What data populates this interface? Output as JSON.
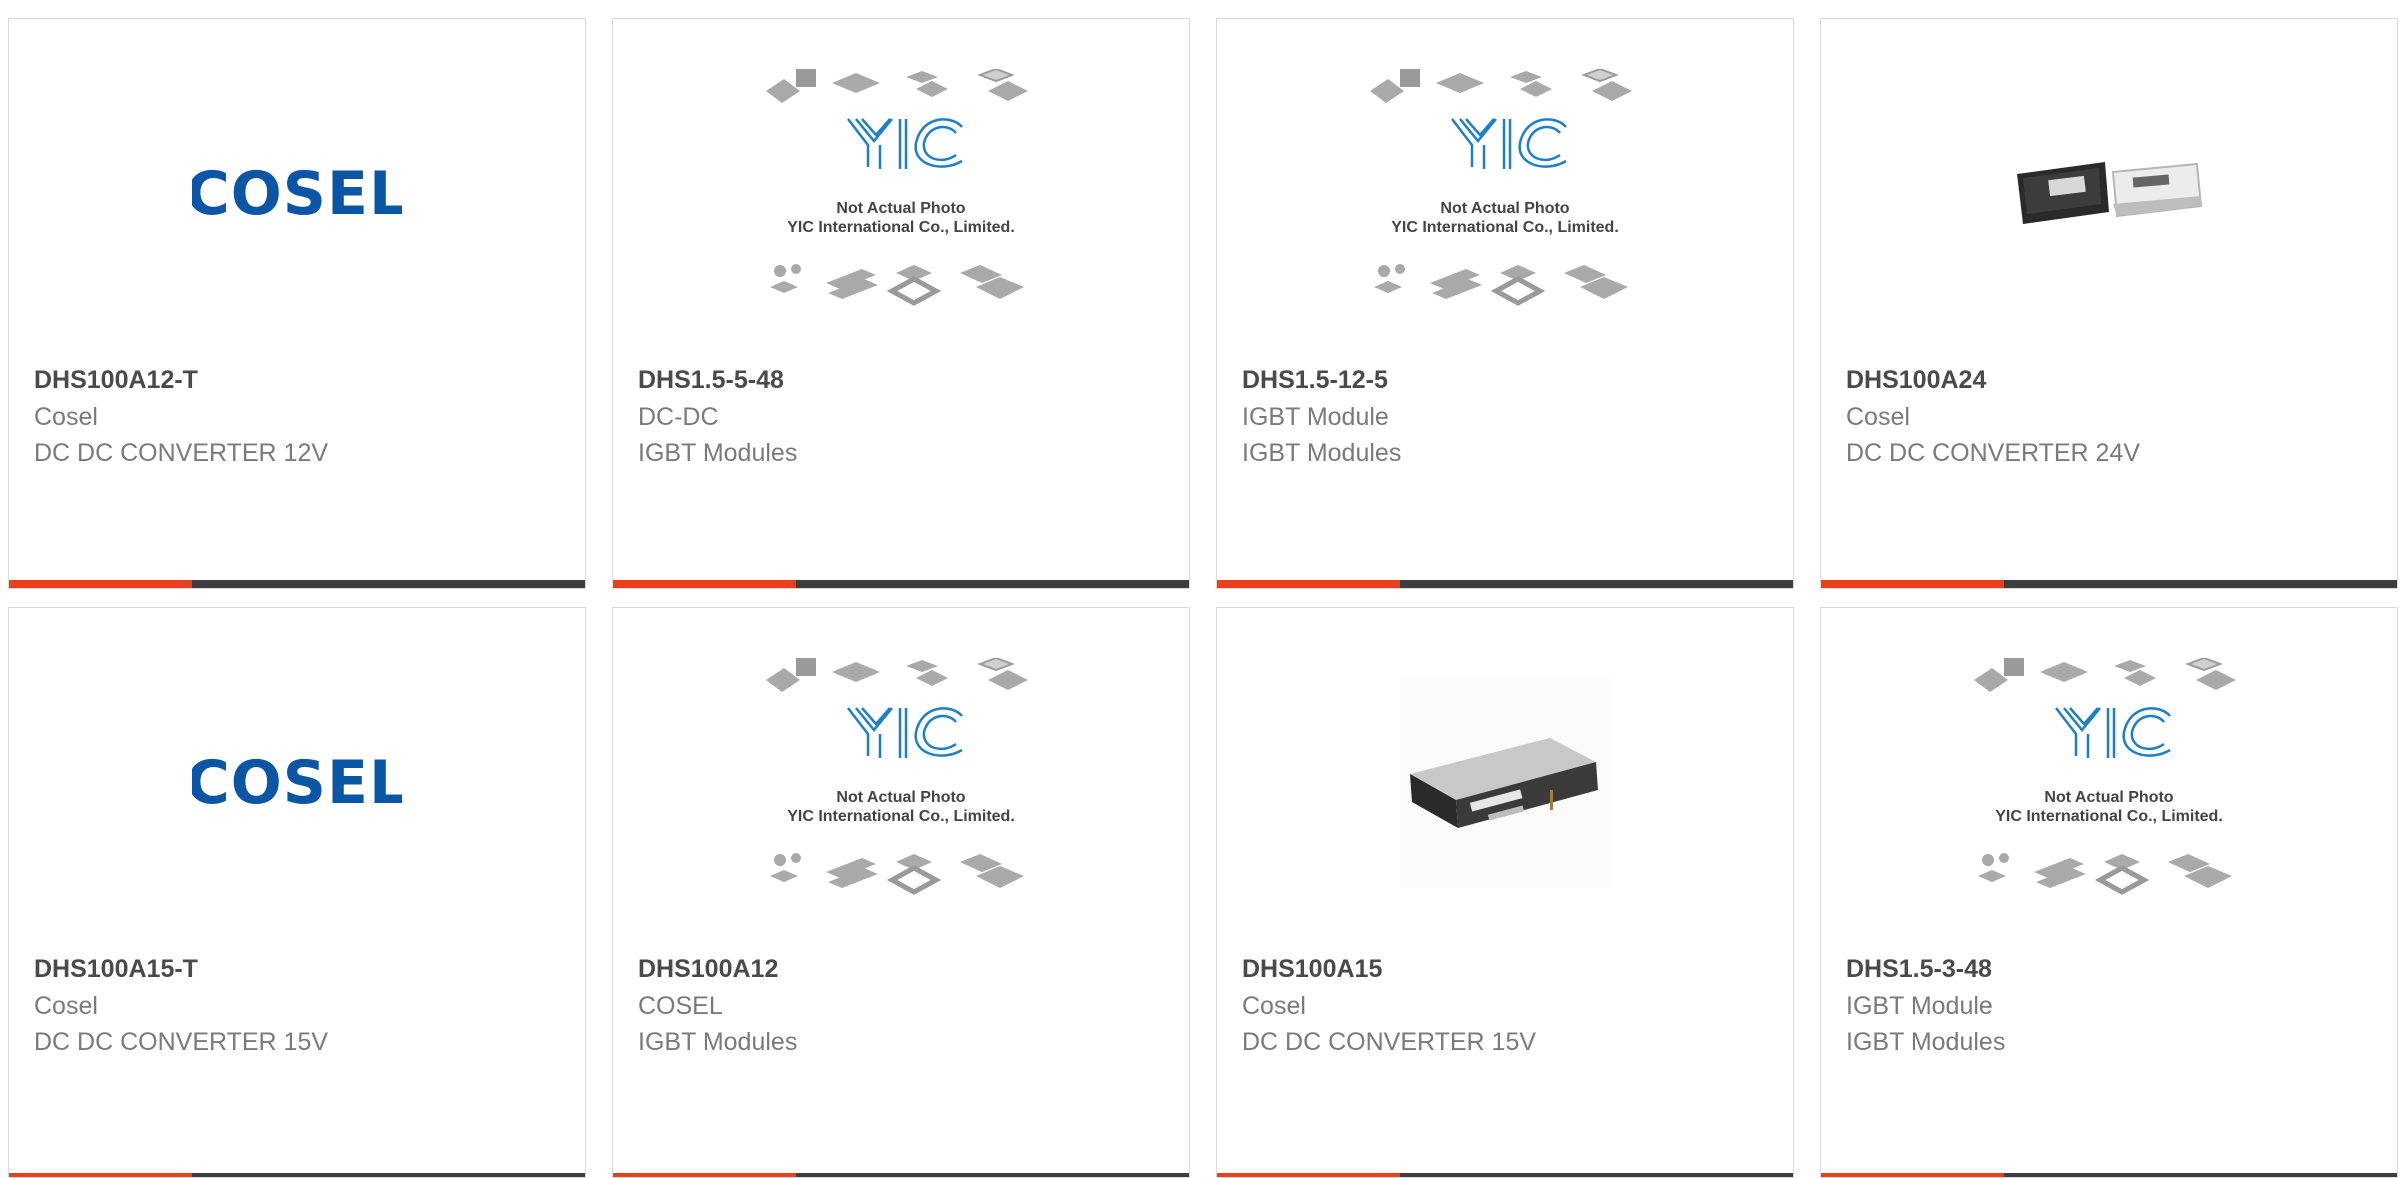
{
  "products": [
    {
      "part_number": "DHS100A12-T",
      "manufacturer": "Cosel",
      "description": "DC DC CONVERTER 12V",
      "image": {
        "type": "logo",
        "text": "COSEL",
        "color": "#0a55a4"
      }
    },
    {
      "part_number": "DHS1.5-5-48",
      "manufacturer": "DC-DC",
      "description": "IGBT Modules",
      "image": {
        "type": "placeholder",
        "logo_text": "YIC",
        "line1": "Not Actual Photo",
        "line2": "YIC International Co., Limited."
      }
    },
    {
      "part_number": "DHS1.5-12-5",
      "manufacturer": "IGBT Module",
      "description": "IGBT Modules",
      "image": {
        "type": "placeholder",
        "logo_text": "YIC",
        "line1": "Not Actual Photo",
        "line2": "YIC International Co., Limited."
      }
    },
    {
      "part_number": "DHS100A24",
      "manufacturer": "Cosel",
      "description": "DC DC CONVERTER 24V",
      "image": {
        "type": "photo-two-modules"
      }
    },
    {
      "part_number": "DHS100A15-T",
      "manufacturer": "Cosel",
      "description": "DC DC CONVERTER 15V",
      "image": {
        "type": "logo",
        "text": "COSEL",
        "color": "#0a55a4"
      }
    },
    {
      "part_number": "DHS100A12",
      "manufacturer": "COSEL",
      "description": "IGBT Modules",
      "image": {
        "type": "placeholder",
        "logo_text": "YIC",
        "line1": "Not Actual Photo",
        "line2": "YIC International Co., Limited."
      }
    },
    {
      "part_number": "DHS100A15",
      "manufacturer": "Cosel",
      "description": "DC DC CONVERTER 15V",
      "image": {
        "type": "photo-single-module"
      }
    },
    {
      "part_number": "DHS1.5-3-48",
      "manufacturer": "IGBT Module",
      "description": "IGBT Modules",
      "image": {
        "type": "placeholder",
        "logo_text": "YIC",
        "line1": "Not Actual Photo",
        "line2": "YIC International Co., Limited."
      }
    }
  ],
  "colors": {
    "accent_bar": "#e8401c",
    "dark_bar": "#3d3d3d",
    "cosel_blue": "#0a55a4",
    "yic_blue": "#1f7fc4",
    "chip_gray": "#a9a9a9"
  }
}
